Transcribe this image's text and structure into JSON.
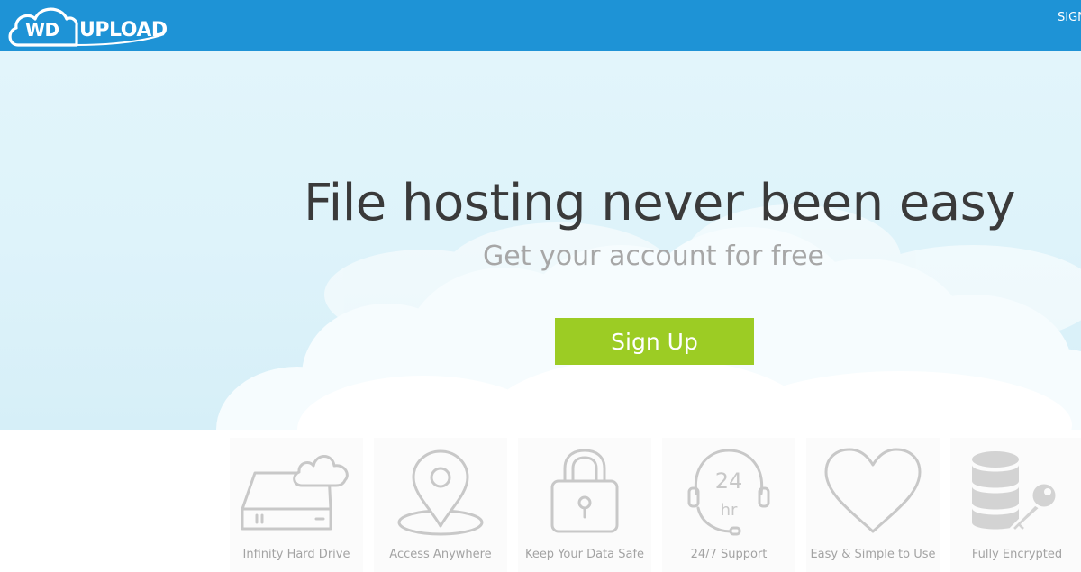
{
  "header": {
    "logo_prefix": "WD",
    "logo_suffix": "UPLOAD",
    "signin_label": "SIGN IN"
  },
  "hero": {
    "headline": "File hosting never been easy",
    "subheadline": "Get your account for free",
    "cta_label": "Sign Up"
  },
  "features": [
    {
      "label": "Infinity Hard Drive",
      "icon": "hard-drive-cloud-icon"
    },
    {
      "label": "Access Anywhere",
      "icon": "location-pin-icon"
    },
    {
      "label": "Keep Your Data Safe",
      "icon": "padlock-icon"
    },
    {
      "label": "24/7 Support",
      "icon": "headset-24hr-icon",
      "icon_text_top": "24",
      "icon_text_bottom": "hr"
    },
    {
      "label": "Easy & Simple to Use",
      "icon": "heart-icon"
    },
    {
      "label": "Fully Encrypted",
      "icon": "database-key-icon"
    }
  ],
  "colors": {
    "header_bg": "#1e93d6",
    "cta_bg": "#9ccc24",
    "hero_bg": "#e2f5fb",
    "headline": "#3a3a3a",
    "muted_text": "#a7a7a7"
  }
}
